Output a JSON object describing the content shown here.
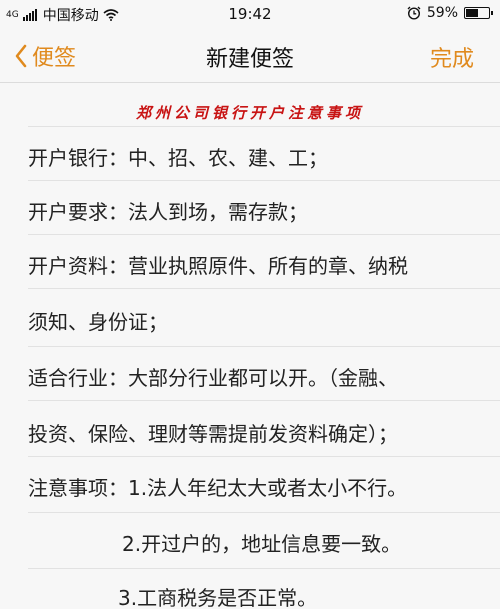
{
  "status_bar": {
    "carrier": "中国移动",
    "network": "4G",
    "time": "19:42",
    "battery": "59%",
    "battery_level": 0.59,
    "icons": [
      "signal-icon",
      "wifi-icon",
      "alarm-icon",
      "battery-icon"
    ]
  },
  "nav": {
    "back_label": "便签",
    "title": "新建便签",
    "done_label": "完成",
    "accent_color": "#e08a1e"
  },
  "note": {
    "heading": "郑州公司银行开户注意事项",
    "heading_color": "#c81414",
    "lines": [
      "开户银行：中、招、农、建、工；",
      "开户要求：法人到场，需存款；",
      "开户资料：营业执照原件、所有的章、纳税",
      "须知、身份证；",
      "适合行业：大部分行业都可以开。（金融、",
      "投资、保险、理财等需提前发资料确定）；",
      "注意事项：1.法人年纪太大或者太小不行。",
      "2.开过户的，地址信息要一致。",
      "3.工商税务是否正常。"
    ]
  }
}
